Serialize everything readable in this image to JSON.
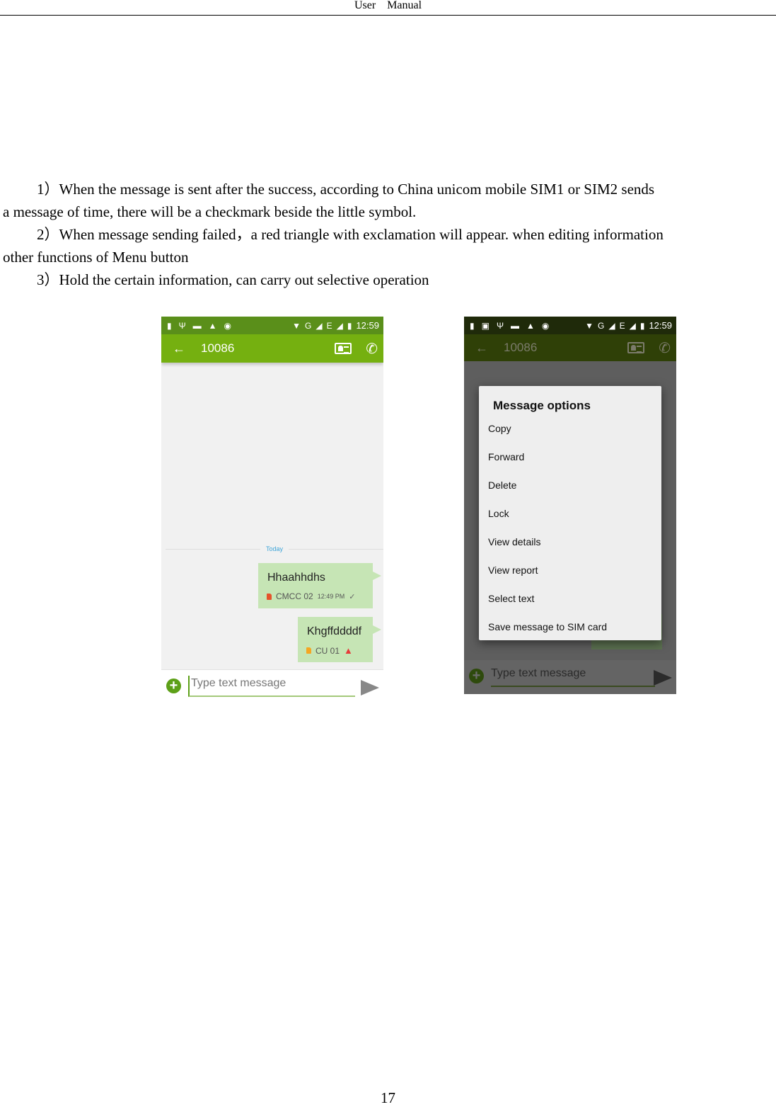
{
  "header": {
    "title": "User    Manual"
  },
  "paragraphs": [
    {
      "line1": "1）When the message is sent after the success, according to China unicom mobile SIM1 or SIM2 sends",
      "line2": "a message of time, there will be a checkmark beside the little symbol."
    },
    {
      "line1": "2）When message sending failed，a red triangle with exclamation will appear. when editing information",
      "line2": "other functions of Menu button"
    },
    {
      "line1": "3）Hold the certain information, can carry out selective operation"
    }
  ],
  "screen1": {
    "status": {
      "time": "12:59",
      "net1": "G",
      "net2": "E",
      "left_icons": [
        "sd-card-icon",
        "usb-icon",
        "battery-saver-icon",
        "warning-icon",
        "android-icon"
      ]
    },
    "appbar": {
      "back": "←",
      "contact": "10086"
    },
    "divider_label": "Today",
    "messages": [
      {
        "text": "Hhaahhdhs",
        "sim": "CMCC 02",
        "time": "12:49 PM",
        "status": "sent",
        "sim_color": "#e5532b"
      },
      {
        "text": "Khgffddddf",
        "sim": "CU 01",
        "status": "failed",
        "sim_color": "#f5a623"
      }
    ],
    "composer": {
      "placeholder": "Type text message"
    }
  },
  "screen2": {
    "status": {
      "time": "12:59",
      "net1": "G",
      "net2": "E"
    },
    "appbar": {
      "back": "←",
      "contact": "10086"
    },
    "dialog": {
      "title": "Message options",
      "options": [
        "Copy",
        "Forward",
        "Delete",
        "Lock",
        "View details",
        "View report",
        "Select text",
        "Save message to SIM card"
      ]
    },
    "composer": {
      "placeholder": "Type text message"
    }
  },
  "page_number": "17"
}
